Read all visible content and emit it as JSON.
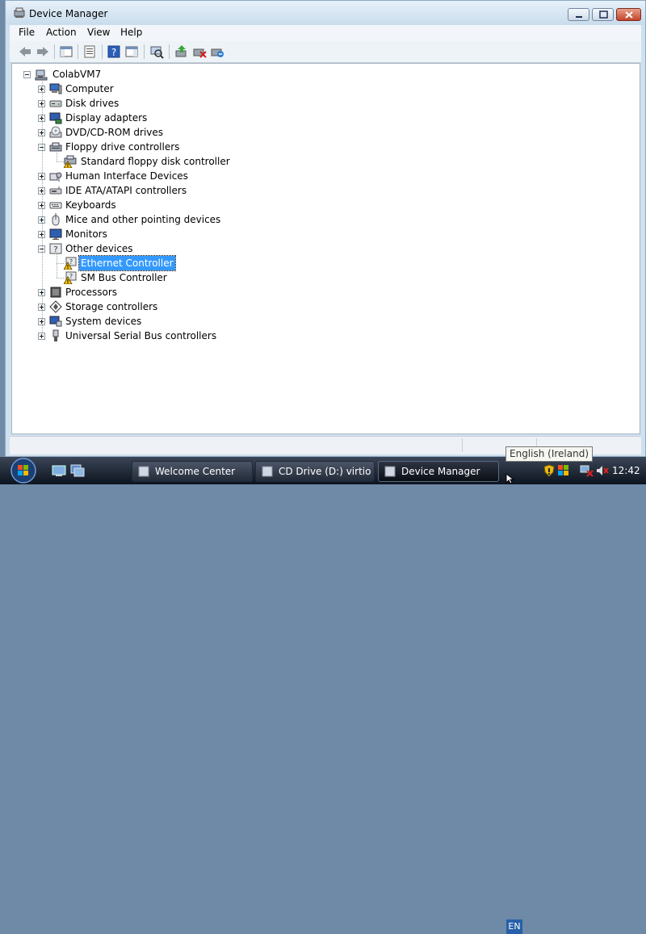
{
  "window": {
    "title": "Device Manager",
    "menu": [
      "File",
      "Action",
      "View",
      "Help"
    ]
  },
  "tree": {
    "root": "ColabVM7",
    "categories": [
      {
        "label": "Computer",
        "icon": "computer-icon",
        "expanded": false
      },
      {
        "label": "Disk drives",
        "icon": "disk-drive-icon",
        "expanded": false
      },
      {
        "label": "Display adapters",
        "icon": "display-adapter-icon",
        "expanded": false
      },
      {
        "label": "DVD/CD-ROM drives",
        "icon": "dvd-drive-icon",
        "expanded": false
      },
      {
        "label": "Floppy drive controllers",
        "icon": "floppy-controller-icon",
        "expanded": true,
        "children": [
          {
            "label": "Standard floppy disk controller",
            "icon": "floppy-controller-warning-icon"
          }
        ]
      },
      {
        "label": "Human Interface Devices",
        "icon": "hid-icon",
        "expanded": false
      },
      {
        "label": "IDE ATA/ATAPI controllers",
        "icon": "ide-controller-icon",
        "expanded": false
      },
      {
        "label": "Keyboards",
        "icon": "keyboard-icon",
        "expanded": false
      },
      {
        "label": "Mice and other pointing devices",
        "icon": "mouse-icon",
        "expanded": false
      },
      {
        "label": "Monitors",
        "icon": "monitor-icon",
        "expanded": false
      },
      {
        "label": "Other devices",
        "icon": "unknown-device-icon",
        "expanded": true,
        "children": [
          {
            "label": "Ethernet Controller",
            "icon": "unknown-device-warning-icon",
            "selected": true
          },
          {
            "label": "SM Bus Controller",
            "icon": "unknown-device-warning-icon"
          }
        ]
      },
      {
        "label": "Processors",
        "icon": "processor-icon",
        "expanded": false
      },
      {
        "label": "Storage controllers",
        "icon": "storage-controller-icon",
        "expanded": false
      },
      {
        "label": "System devices",
        "icon": "system-device-icon",
        "expanded": false
      },
      {
        "label": "Universal Serial Bus controllers",
        "icon": "usb-icon",
        "expanded": false
      }
    ]
  },
  "taskbar": {
    "tasks": [
      {
        "label": "Welcome Center",
        "active": false
      },
      {
        "label": "CD Drive (D:) virtio...",
        "active": false
      },
      {
        "label": "Device Manager",
        "active": true
      }
    ],
    "language": "EN",
    "language_tooltip": "English (Ireland)",
    "clock": "12:42"
  },
  "colors": {
    "selection": "#3399ff",
    "warning": "#f5c400",
    "taskbar": "#0d1420"
  }
}
